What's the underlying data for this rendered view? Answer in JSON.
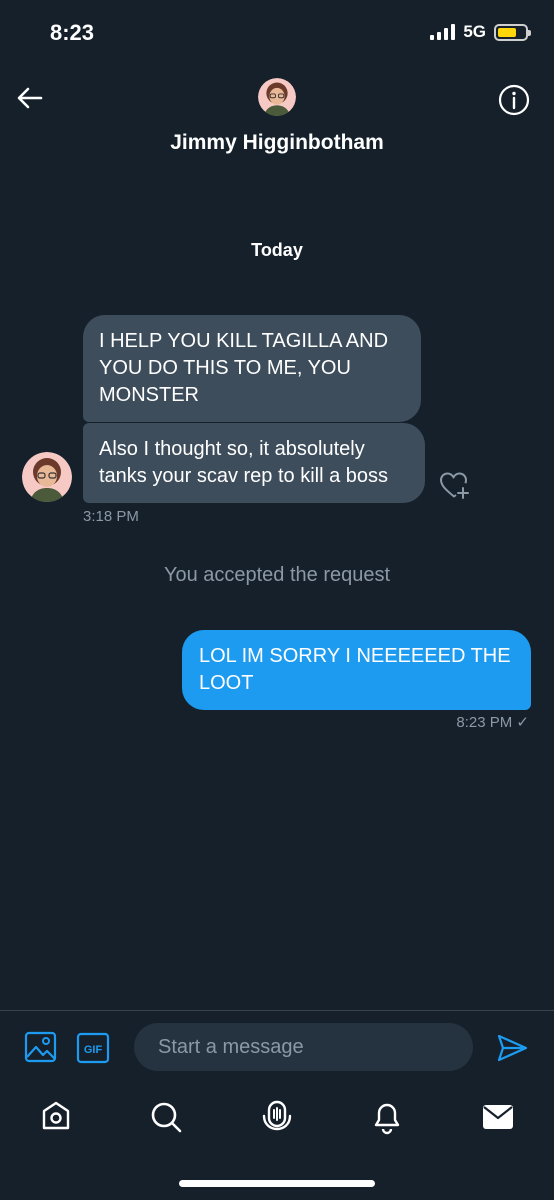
{
  "status_bar": {
    "time": "8:23",
    "network": "5G"
  },
  "header": {
    "name": "Jimmy Higginbotham"
  },
  "conversation": {
    "date_separator": "Today",
    "incoming": [
      {
        "text": "I HELP YOU KILL TAGILLA AND YOU DO THIS TO ME, YOU MONSTER"
      },
      {
        "text": "Also I thought so, it absolutely tanks your scav rep to kill a boss"
      }
    ],
    "incoming_time": "3:18 PM",
    "system_note": "You accepted the request",
    "outgoing": {
      "text": "LOL IM SORRY I NEEEEEED THE LOOT",
      "time": "8:23 PM ✓"
    }
  },
  "composer": {
    "placeholder": "Start a message"
  },
  "colors": {
    "background": "#15202b",
    "accent": "#1d9bf0",
    "incoming_bubble": "#3d4d5c",
    "muted_text": "#8b98a5"
  },
  "icons": [
    "back-arrow-icon",
    "info-icon",
    "like-icon",
    "image-icon",
    "gif-icon",
    "send-icon",
    "home-icon",
    "search-icon",
    "spaces-icon",
    "bell-icon",
    "mail-icon"
  ]
}
